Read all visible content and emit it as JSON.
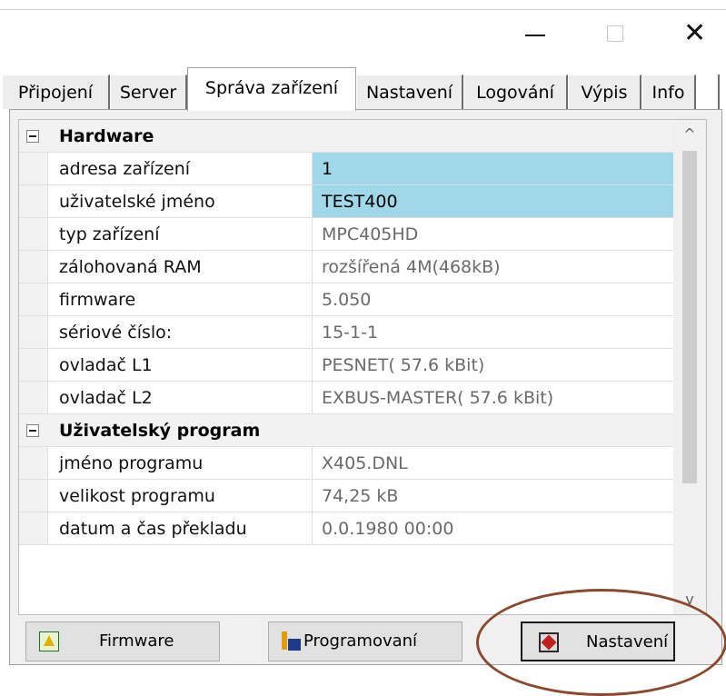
{
  "window": {
    "minimize_label": "",
    "maximize_label": "",
    "close_glyph": "✕"
  },
  "tabs": [
    {
      "label": "Připojení",
      "active": false
    },
    {
      "label": "Server",
      "active": false
    },
    {
      "label": "Správa zařízení",
      "active": true
    },
    {
      "label": "Nastavení",
      "active": false
    },
    {
      "label": "Logování",
      "active": false
    },
    {
      "label": "Výpis",
      "active": false
    },
    {
      "label": "Info",
      "active": false
    }
  ],
  "grid": {
    "categories": [
      {
        "title": "Hardware",
        "rows": [
          {
            "label": "adresa zařízení",
            "value": "1",
            "editable": true
          },
          {
            "label": "uživatelské jméno",
            "value": "TEST400",
            "editable": true
          },
          {
            "label": "typ zařízení",
            "value": "MPC405HD",
            "editable": false
          },
          {
            "label": "zálohovaná RAM",
            "value": "rozšířená 4M(468kB)",
            "editable": false
          },
          {
            "label": "firmware",
            "value": "5.050",
            "editable": false
          },
          {
            "label": "sériové číslo:",
            "value": "15-1-1",
            "editable": false
          },
          {
            "label": "ovladač L1",
            "value": "PESNET( 57.6 kBit)",
            "editable": false
          },
          {
            "label": "ovladač L2",
            "value": "EXBUS-MASTER( 57.6 kBit)",
            "editable": false
          }
        ]
      },
      {
        "title": "Uživatelský program",
        "rows": [
          {
            "label": "jméno programu",
            "value": "X405.DNL",
            "editable": false
          },
          {
            "label": "velikost programu",
            "value": "74,25 kB",
            "editable": false
          },
          {
            "label": "datum a čas překladu",
            "value": "0.0.1980  00:00",
            "editable": false
          }
        ]
      }
    ]
  },
  "scrollbar": {
    "up_glyph": "^",
    "down_glyph": "v"
  },
  "buttons": {
    "firmware": "Firmware",
    "programming": "Programovaní",
    "settings": "Nastavení"
  },
  "colors": {
    "editable_cell": "#9fd8e8",
    "highlight_ellipse": "#8b4a30"
  }
}
